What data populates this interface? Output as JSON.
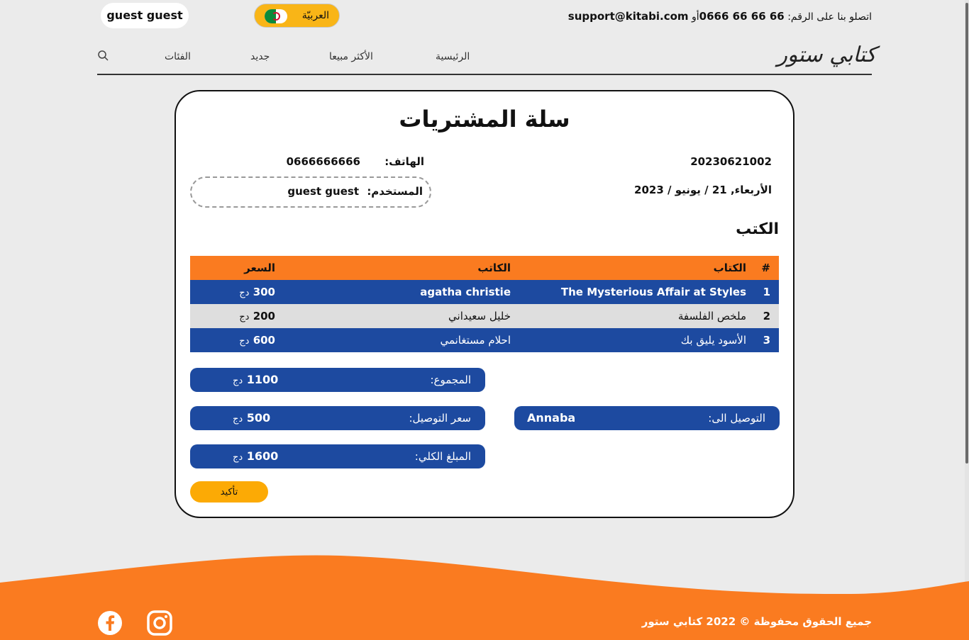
{
  "header": {
    "user_name": "guest guest",
    "language": "العربيّة",
    "contact_prefix": "اتصلو بنا على الرقم:",
    "phone": "66 66 66 0666",
    "contact_or": "أو",
    "email": "support@kitabi.com"
  },
  "nav": {
    "brand": "كتابي ستور",
    "items": [
      "الرئيسية",
      "الأكثر مبيعا",
      "جديد",
      "الفئات"
    ]
  },
  "cart": {
    "title": "سلة المشتريات",
    "order_number": "20230621002",
    "date": "الأربعاء, 21 / يونيو / 2023",
    "phone_label": "الهاتف:",
    "phone_value": "0666666666",
    "user_label": "المستخدم:",
    "user_value": "guest guest",
    "books_title": "الكتب",
    "table_headers": {
      "num": "#",
      "book": "الكتاب",
      "author": "الكاتب",
      "price": "السعر"
    },
    "currency": "دج",
    "rows": [
      {
        "num": "1",
        "book": "The Mysterious Affair at Styles",
        "author": "agatha christie",
        "price": "300"
      },
      {
        "num": "2",
        "book": "ملخص الفلسفة",
        "author": "خليل سعيداني",
        "price": "200"
      },
      {
        "num": "3",
        "book": "الأسود يليق بك",
        "author": "احلام مستغانمي",
        "price": "600"
      }
    ],
    "subtotal_label": "المجموع:",
    "subtotal_value": "1100",
    "shipping_label": "سعر التوصيل:",
    "shipping_value": "500",
    "total_label": "المبلغ الكلي:",
    "total_value": "1600",
    "deliver_label": "التوصيل الى:",
    "deliver_value": "Annaba",
    "confirm_label": "تأكيد"
  },
  "footer": {
    "copyright": "جميع الحقوق محفوظة © 2022 كتابي ستور"
  },
  "colors": {
    "orange": "#fa7b20",
    "blue": "#1d4aa0",
    "yellow": "#fcaa05"
  }
}
